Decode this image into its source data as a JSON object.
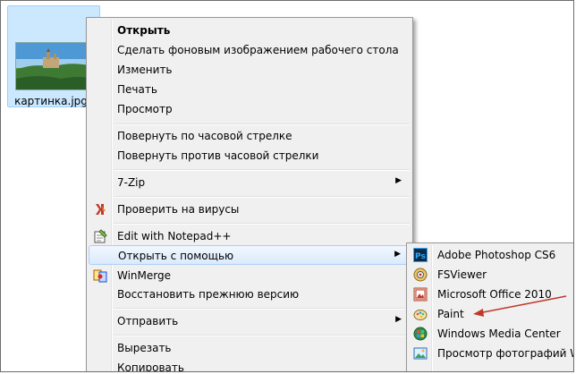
{
  "file": {
    "name": "картинка.jpg"
  },
  "context_menu": {
    "open": "Открыть",
    "set_wallpaper": "Сделать фоновым изображением рабочего стола",
    "edit": "Изменить",
    "print": "Печать",
    "preview": "Просмотр",
    "rotate_cw": "Повернуть по часовой стрелке",
    "rotate_ccw": "Повернуть против часовой стрелки",
    "sevenzip": "7-Zip",
    "scan": "Проверить на вирусы",
    "notepadpp": "Edit with Notepad++",
    "open_with": "Открыть с помощью",
    "winmerge": "WinMerge",
    "restore": "Восстановить прежнюю версию",
    "send_to": "Отправить",
    "cut": "Вырезать",
    "copy": "Копировать"
  },
  "submenu": {
    "items": [
      {
        "label": "Adobe Photoshop CS6",
        "icon": "photoshop-icon"
      },
      {
        "label": "FSViewer",
        "icon": "fsviewer-icon"
      },
      {
        "label": "Microsoft Office 2010",
        "icon": "office-picture-icon"
      },
      {
        "label": "Paint",
        "icon": "paint-icon"
      },
      {
        "label": "Windows Media Center",
        "icon": "media-center-icon"
      },
      {
        "label": "Просмотр фотографий Windows",
        "icon": "photo-viewer-icon"
      }
    ]
  },
  "colors": {
    "highlight_bg": "#dbeafb",
    "highlight_border": "#aecff7",
    "selection_bg": "#cce8ff",
    "annotation_arrow": "#c0392b"
  }
}
